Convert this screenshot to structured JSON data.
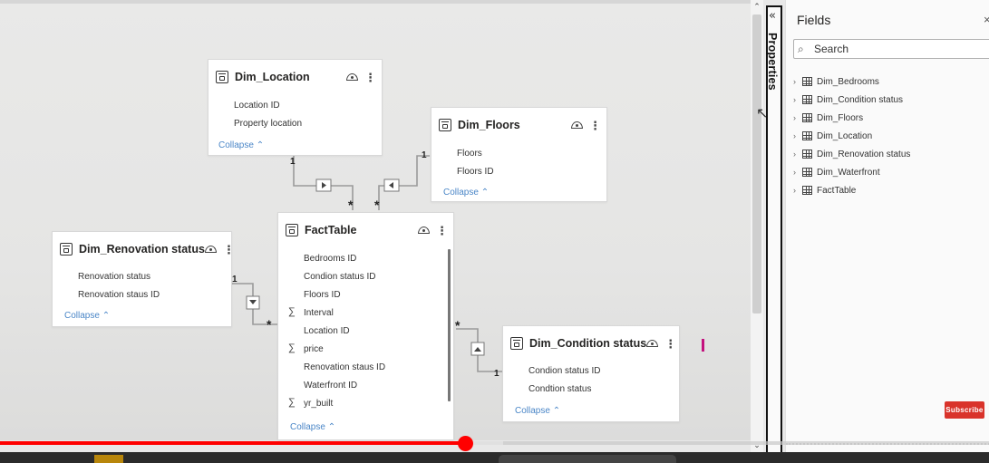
{
  "model_view": {
    "tables": [
      {
        "name": "Dim_Location",
        "fields": [
          "Location ID",
          "Property location"
        ],
        "collapse_label": "Collapse"
      },
      {
        "name": "Dim_Floors",
        "fields": [
          "Floors",
          "Floors ID"
        ],
        "collapse_label": "Collapse"
      },
      {
        "name": "FactTable",
        "fields": [
          "Bedrooms ID",
          "Condion status ID",
          "Floors ID",
          "Interval",
          "Location ID",
          "price",
          "Renovation staus ID",
          "Waterfront ID",
          "yr_built"
        ],
        "collapse_label": "Collapse"
      },
      {
        "name": "Dim_Renovation status",
        "fields": [
          "Renovation status",
          "Renovation staus ID"
        ],
        "collapse_label": "Collapse"
      },
      {
        "name": "Dim_Condition status",
        "fields": [
          "Condion status ID",
          "Condtion status"
        ],
        "collapse_label": "Collapse"
      }
    ],
    "relationships": {
      "one": "1",
      "many": "*"
    }
  },
  "properties_pane": {
    "label": "Properties",
    "collapse_glyph": "«"
  },
  "fields_pane": {
    "title": "Fields",
    "close_glyph": "×",
    "search_placeholder": "Search",
    "items": [
      "Dim_Bedrooms",
      "Dim_Condition status",
      "Dim_Floors",
      "Dim_Location",
      "Dim_Renovation status",
      "Dim_Waterfront",
      "FactTable"
    ]
  },
  "overlay": {
    "subscribe_label": "Subscribe"
  },
  "video": {
    "progress_fraction": 0.47
  },
  "icons": {
    "table": "table-icon",
    "visibility": "eye-icon",
    "more": "more-options-icon",
    "sigma": "sum-icon",
    "expand": "chevron-right-icon"
  },
  "colors": {
    "accent": "#4a86c7",
    "video_progress": "#ff0000",
    "subscribe": "#d9332b"
  }
}
